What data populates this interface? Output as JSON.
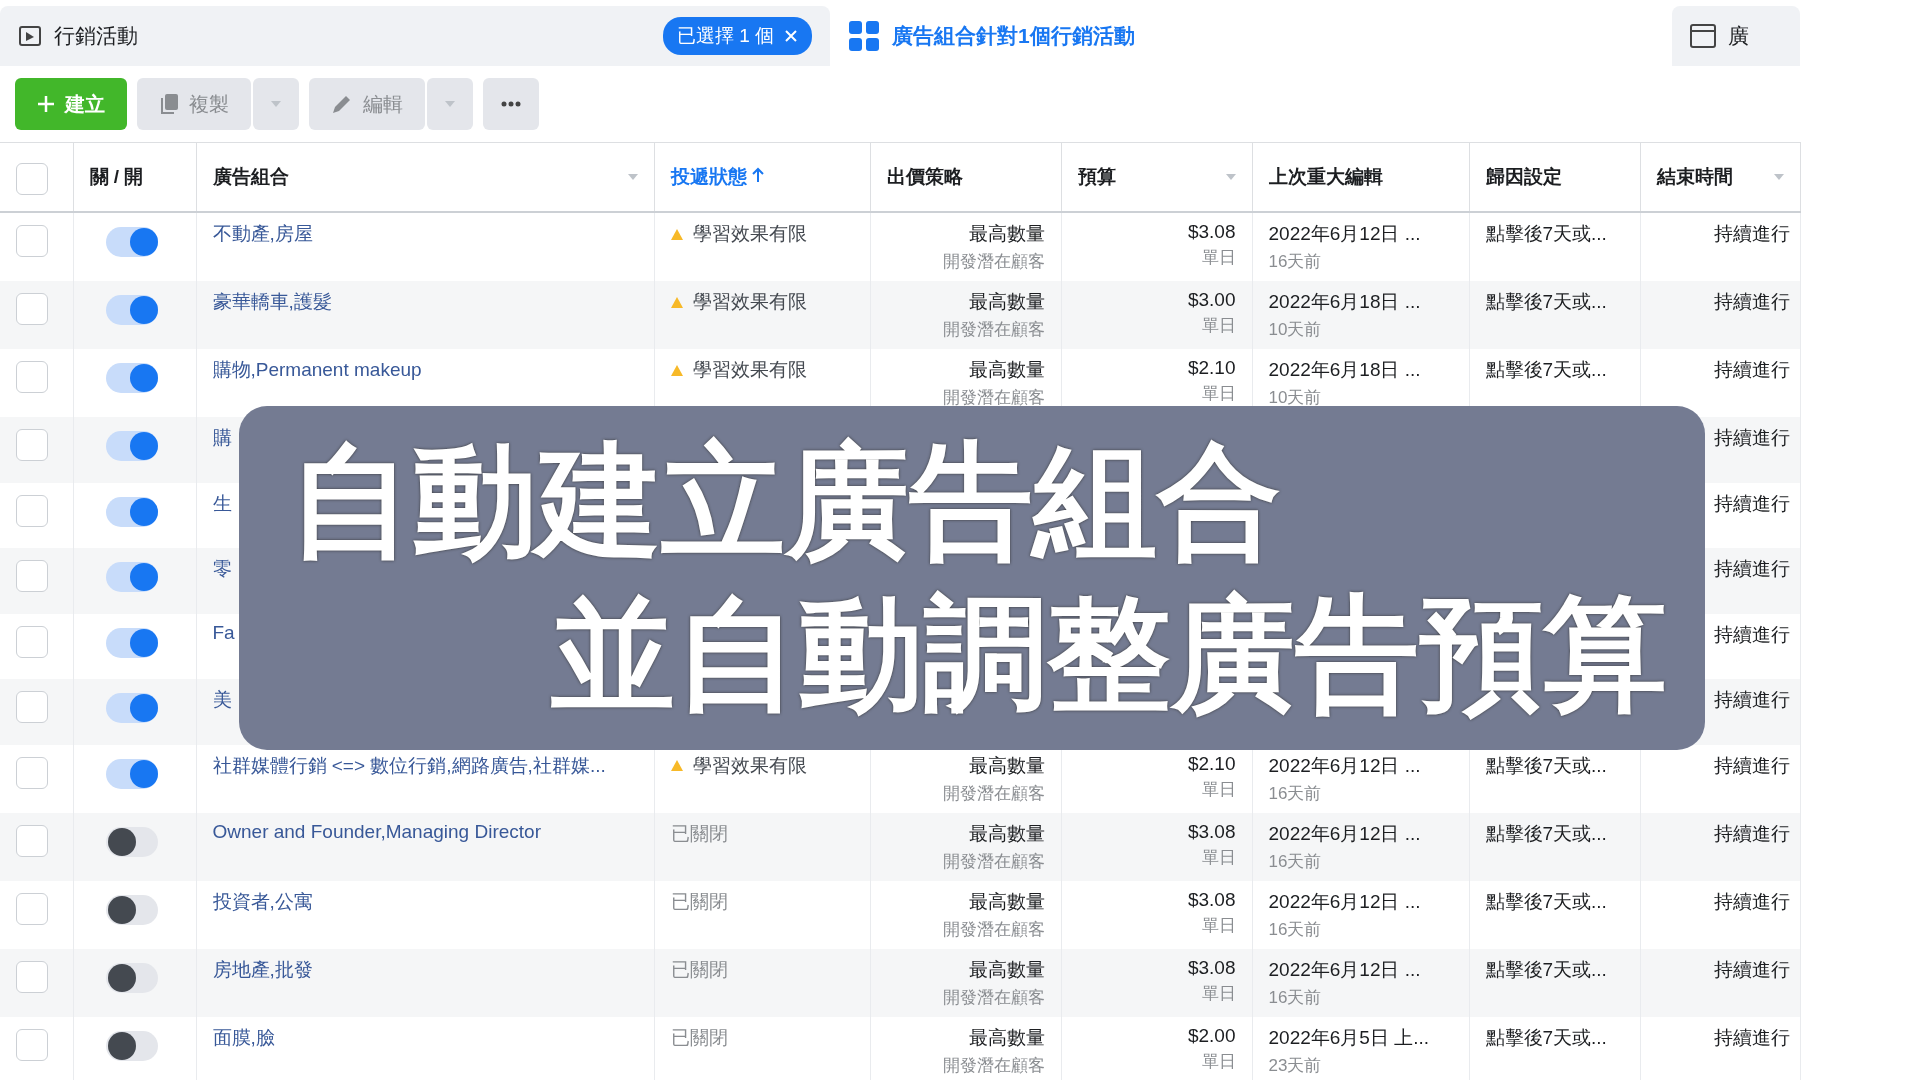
{
  "tabs": [
    {
      "label": "行銷活動",
      "selected": false,
      "chip": "已選擇 1 個"
    },
    {
      "label": "廣告組合針對1個行銷活動",
      "selected": true
    },
    {
      "label": "廣",
      "selected": false
    }
  ],
  "toolbar": {
    "create": "建立",
    "copy": "複製",
    "edit": "編輯"
  },
  "table": {
    "select_all_checked": false,
    "columns": [
      {
        "label": "關 / 開",
        "sorted": false,
        "has_menu": false
      },
      {
        "label": "廣告組合",
        "sorted": false,
        "has_menu": true
      },
      {
        "label": "投遞狀態",
        "sorted": true,
        "has_menu": false
      },
      {
        "label": "出價策略",
        "sorted": false,
        "has_menu": false
      },
      {
        "label": "預算",
        "sorted": false,
        "has_menu": true
      },
      {
        "label": "上次重大編輯",
        "sorted": false,
        "has_menu": false
      },
      {
        "label": "歸因設定",
        "sorted": false,
        "has_menu": false
      },
      {
        "label": "結束時間",
        "sorted": false,
        "has_menu": true
      }
    ],
    "rows": [
      {
        "checked": false,
        "on": true,
        "name": "不動產,房屋",
        "kind": "learning",
        "status": "學習效果有限",
        "bid": "最高數量",
        "goal": "開發潛在顧客",
        "budget": "$3.08",
        "period": "單日",
        "edited": "2022年6月12日 ...",
        "ago": "16天前",
        "attribution": "點擊後7天或...",
        "end": "持續進行"
      },
      {
        "checked": false,
        "on": true,
        "name": "豪華轎車,護髮",
        "kind": "learning",
        "status": "學習效果有限",
        "bid": "最高數量",
        "goal": "開發潛在顧客",
        "budget": "$3.00",
        "period": "單日",
        "edited": "2022年6月18日 ...",
        "ago": "10天前",
        "attribution": "點擊後7天或...",
        "end": "持續進行"
      },
      {
        "checked": false,
        "on": true,
        "name": "購物,Permanent makeup",
        "kind": "learning",
        "status": "學習效果有限",
        "bid": "最高數量",
        "goal": "開發潛在顧客",
        "budget": "$2.10",
        "period": "單日",
        "edited": "2022年6月18日 ...",
        "ago": "10天前",
        "attribution": "點擊後7天或...",
        "end": "持續進行"
      },
      {
        "checked": false,
        "on": true,
        "name": "購",
        "end": "持續進行"
      },
      {
        "checked": false,
        "on": true,
        "name": "生",
        "end": "持續進行"
      },
      {
        "checked": false,
        "on": true,
        "name": "零",
        "end": "持續進行"
      },
      {
        "checked": false,
        "on": true,
        "name": "Fa",
        "end": "持續進行"
      },
      {
        "checked": false,
        "on": true,
        "name": "美",
        "end": "持續進行"
      },
      {
        "checked": false,
        "on": true,
        "name": "社群媒體行銷 <=> 數位行銷,網路廣告,社群媒...",
        "kind": "learning",
        "status": "學習效果有限",
        "bid": "最高數量",
        "goal": "開發潛在顧客",
        "budget": "$2.10",
        "period": "單日",
        "edited": "2022年6月12日 ...",
        "ago": "16天前",
        "attribution": "點擊後7天或...",
        "end": "持續進行"
      },
      {
        "checked": false,
        "on": false,
        "name": "Owner and Founder,Managing Director",
        "kind": "off",
        "status": "已關閉",
        "bid": "最高數量",
        "goal": "開發潛在顧客",
        "budget": "$3.08",
        "period": "單日",
        "edited": "2022年6月12日 ...",
        "ago": "16天前",
        "attribution": "點擊後7天或...",
        "end": "持續進行"
      },
      {
        "checked": false,
        "on": false,
        "name": "投資者,公寓",
        "kind": "off",
        "status": "已關閉",
        "bid": "最高數量",
        "goal": "開發潛在顧客",
        "budget": "$3.08",
        "period": "單日",
        "edited": "2022年6月12日 ...",
        "ago": "16天前",
        "attribution": "點擊後7天或...",
        "end": "持續進行"
      },
      {
        "checked": false,
        "on": false,
        "name": "房地產,批發",
        "kind": "off",
        "status": "已關閉",
        "bid": "最高數量",
        "goal": "開發潛在顧客",
        "budget": "$3.08",
        "period": "單日",
        "edited": "2022年6月12日 ...",
        "ago": "16天前",
        "attribution": "點擊後7天或...",
        "end": "持續進行"
      },
      {
        "checked": false,
        "on": false,
        "name": "面膜,臉",
        "kind": "off",
        "status": "已關閉",
        "bid": "最高數量",
        "goal": "開發潛在顧客",
        "budget": "$2.00",
        "period": "單日",
        "edited": "2022年6月5日 上...",
        "ago": "23天前",
        "attribution": "點擊後7天或...",
        "end": "持續進行"
      }
    ]
  },
  "overlay": {
    "lines": [
      "自動建立廣告組合",
      "並自動調整廣告預算"
    ]
  }
}
